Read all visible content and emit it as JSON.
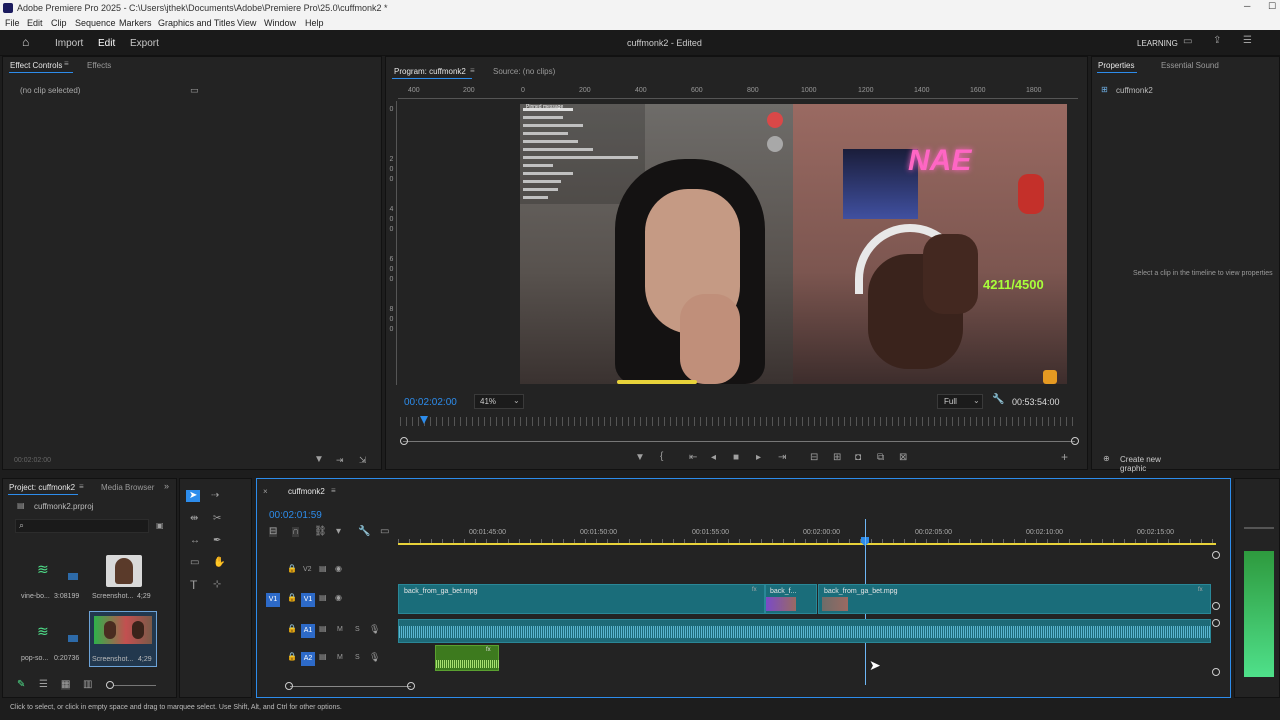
{
  "app": {
    "title": "Adobe Premiere Pro 2025 - C:\\Users\\jthek\\Documents\\Adobe\\Premiere Pro\\25.0\\cuffmonk2 *",
    "menus": [
      "File",
      "Edit",
      "Clip",
      "Sequence",
      "Markers",
      "Graphics and Titles",
      "View",
      "Window",
      "Help"
    ]
  },
  "workspace": {
    "tabs": [
      "Import",
      "Edit",
      "Export"
    ],
    "active": "Edit",
    "doc_title": "cuffmonk2 - Edited",
    "learning": "LEARNING"
  },
  "effect_controls": {
    "tabs": [
      "Effect Controls",
      "Effects"
    ],
    "no_clip": "(no clip selected)",
    "timecode": "00:02:02:00"
  },
  "program": {
    "tab": "Program: cuffmonk2",
    "source_tab": "Source: (no clips)",
    "ruler": [
      "400",
      "200",
      "0",
      "200",
      "400",
      "600",
      "800",
      "1000",
      "1200",
      "1400",
      "1600",
      "1800"
    ],
    "vruler": [
      "0",
      "2",
      "0",
      "0",
      "4",
      "0",
      "0",
      "6",
      "0",
      "0",
      "8",
      "0",
      "0"
    ],
    "timecode": "00:02:02:00",
    "zoom": "41%",
    "quality": "Full",
    "duration": "00:53:54:00",
    "overlay_count": "4211/4500",
    "neon": "NAE",
    "chat_lines": [
      "Pinned message",
      "",
      "",
      "",
      "",
      "",
      "",
      "",
      "",
      "",
      "",
      "",
      ""
    ]
  },
  "properties": {
    "tabs": [
      "Properties",
      "Essential Sound"
    ],
    "item": "cuffmonk2",
    "hint": "Select a clip in the timeline to view properties",
    "create_graphic": "Create new graphic"
  },
  "project": {
    "tabs": [
      "Project: cuffmonk2",
      "Media Browser"
    ],
    "file": "cuffmonk2.prproj",
    "items": [
      {
        "name": "vine-bo...",
        "meta": "3:08199",
        "type": "audio"
      },
      {
        "name": "Screenshot...",
        "meta": "4;29",
        "type": "person"
      },
      {
        "name": "pop-so...",
        "meta": "0:20736",
        "type": "audio"
      },
      {
        "name": "Screenshot...",
        "meta": "4;29",
        "type": "green"
      }
    ]
  },
  "timeline": {
    "tab": "cuffmonk2",
    "timecode": "00:02:01:59",
    "ruler": [
      "00:01:45:00",
      "00:01:50:00",
      "00:01:55:00",
      "00:02:00:00",
      "00:02:05:00",
      "00:02:10:00",
      "00:02:15:00"
    ],
    "tracks": {
      "v2": "V2",
      "v1": "V1",
      "v1_src": "V1",
      "a1": "A1",
      "a2": "A2",
      "m": "M",
      "s": "S"
    },
    "clips": [
      {
        "name": "back_from_ga_bet.mpg"
      },
      {
        "name": "back_f..."
      },
      {
        "name": "back_from_ga_bet.mpg"
      }
    ]
  },
  "status": "Click to select, or click in empty space and drag to marquee select. Use Shift, Alt, and Ctrl for other options.",
  "colors": {
    "accent": "#2d8ceb",
    "clip_video": "#1a6d7a",
    "audio_wave": "#6fd0f0",
    "yellow_bar": "#e8d23a",
    "neon_pink": "#ff66c4",
    "overlay_green": "#a8ff3a"
  }
}
